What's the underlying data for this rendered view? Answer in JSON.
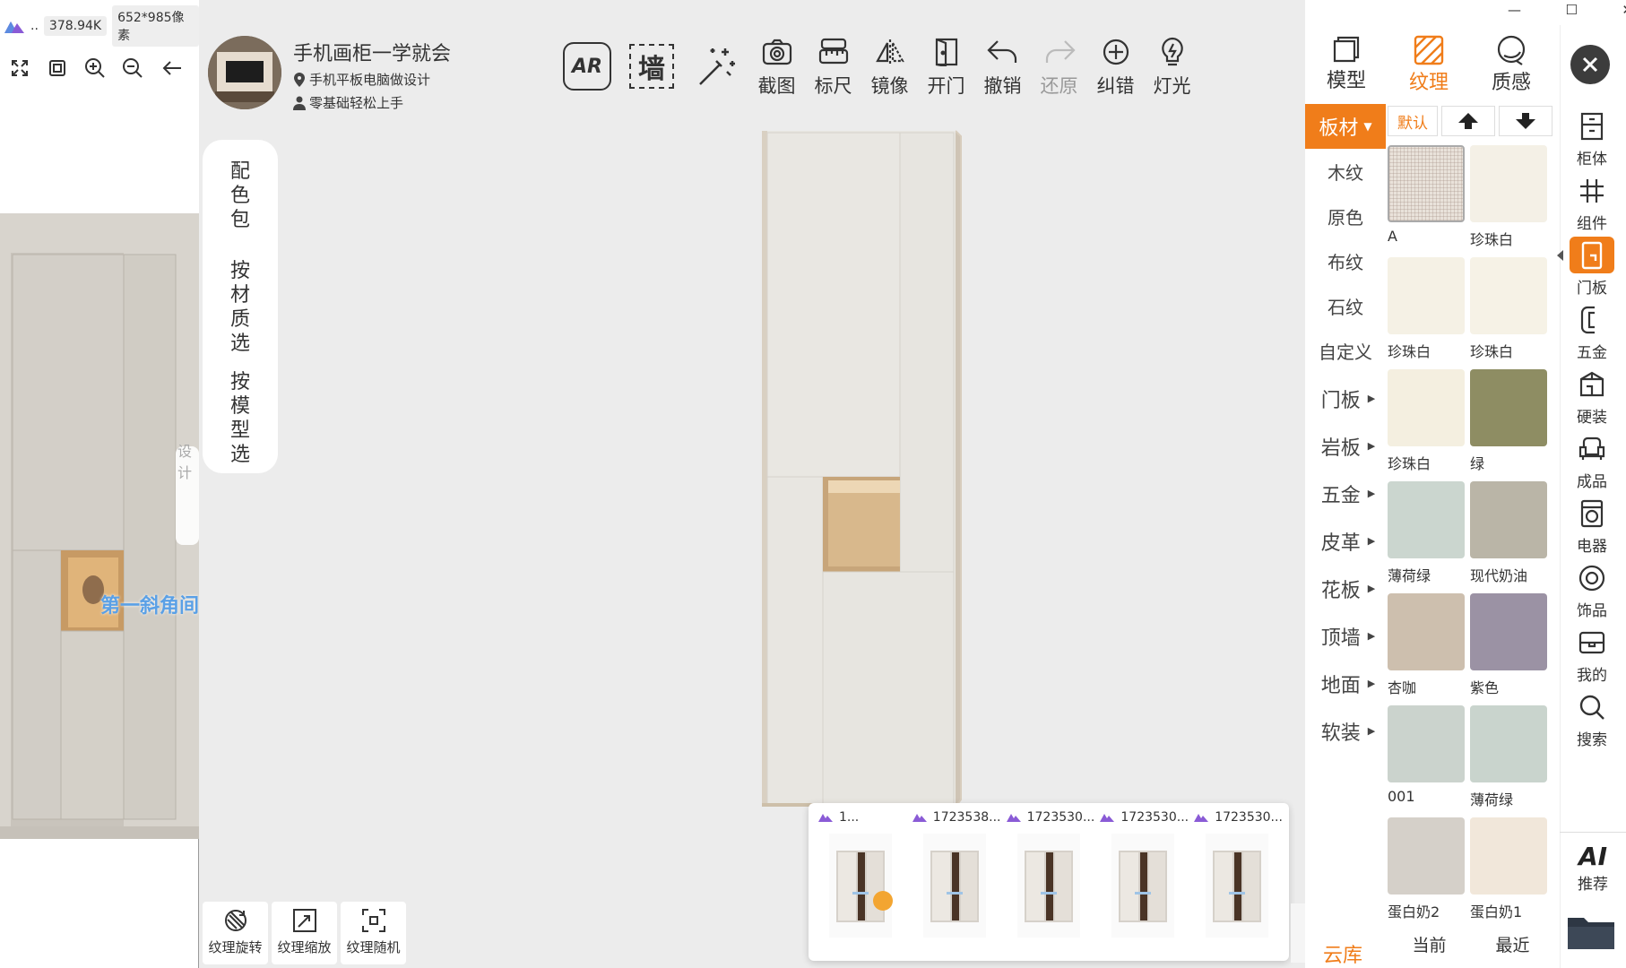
{
  "viewer": {
    "app_short": "..",
    "file_size": "378.94K",
    "dimensions": "652*985像素",
    "tools": [
      "expand-icon",
      "fit-icon",
      "zoom-in-icon",
      "zoom-out-icon",
      "back-arrow-icon"
    ],
    "caption": "第一斜角间",
    "watermark": "设计"
  },
  "window": {
    "minimize": "—",
    "maximize": "☐",
    "close": "✕"
  },
  "profile": {
    "title": "手机画柜一学就会",
    "line1": "手机平板电脑做设计",
    "line2": "零基础轻松上手"
  },
  "toolbar": {
    "ar_label": "AR",
    "wall_label": "墙",
    "items": [
      {
        "label": "截图",
        "icon": "camera-icon"
      },
      {
        "label": "标尺",
        "icon": "ruler-icon"
      },
      {
        "label": "镜像",
        "icon": "mirror-icon"
      },
      {
        "label": "开门",
        "icon": "door-open-icon"
      },
      {
        "label": "撤销",
        "icon": "undo-icon"
      },
      {
        "label": "还原",
        "icon": "redo-icon"
      },
      {
        "label": "纠错",
        "icon": "crosshair-icon"
      },
      {
        "label": "灯光",
        "icon": "bulb-icon"
      }
    ]
  },
  "side_pill": {
    "a": [
      "配",
      "色",
      "包"
    ],
    "b": [
      "按",
      "材",
      "质",
      "选"
    ],
    "c": [
      "按",
      "模",
      "型",
      "选"
    ]
  },
  "bottom_tools": [
    {
      "label": "纹理旋转",
      "icon": "texture-rotate-icon"
    },
    {
      "label": "纹理缩放",
      "icon": "texture-scale-icon"
    },
    {
      "label": "纹理随机",
      "icon": "texture-random-icon"
    }
  ],
  "thumbnails": [
    {
      "title": "1..."
    },
    {
      "title": "1723538..."
    },
    {
      "title": "1723530..."
    },
    {
      "title": "1723530..."
    },
    {
      "title": "1723530..."
    }
  ],
  "panel_tabs": [
    {
      "label": "模型",
      "active": false
    },
    {
      "label": "纹理",
      "active": true
    },
    {
      "label": "质感",
      "active": false
    }
  ],
  "categories": {
    "dropdown": "板材",
    "sub": [
      "木纹",
      "原色",
      "布纹",
      "石纹",
      "自定义"
    ],
    "groups": [
      "门板",
      "岩板",
      "五金",
      "皮革",
      "花板",
      "顶墙",
      "地面",
      "软装"
    ],
    "cloud": "云库"
  },
  "sort": {
    "default": "默认",
    "up": "up-arrow-icon",
    "down": "down-arrow-icon"
  },
  "swatches": [
    {
      "label": "A",
      "color": "#e9e2da",
      "selected": true
    },
    {
      "label": "珍珠白",
      "color": "#f4f0e6"
    },
    {
      "label": "珍珠白",
      "color": "#f5f1e5"
    },
    {
      "label": "珍珠白",
      "color": "#f6f2e6"
    },
    {
      "label": "珍珠白",
      "color": "#f4efe0"
    },
    {
      "label": "绿",
      "color": "#8e8d63"
    },
    {
      "label": "薄荷绿",
      "color": "#cbd6cf"
    },
    {
      "label": "现代奶油",
      "color": "#bab5a7"
    },
    {
      "label": "杏咖",
      "color": "#cdbfae"
    },
    {
      "label": "紫色",
      "color": "#9b92a4"
    },
    {
      "label": "001",
      "color": "#cbd3cd"
    },
    {
      "label": "薄荷绿",
      "color": "#c9d4cd"
    },
    {
      "label": "蛋白奶2",
      "color": "#d5d0c9"
    },
    {
      "label": "蛋白奶1",
      "color": "#f1e7da"
    }
  ],
  "bottom_tabs": [
    "当前",
    "最近"
  ],
  "right_tools": [
    {
      "label": "柜体",
      "icon": "cabinet-icon"
    },
    {
      "label": "组件",
      "icon": "grid-icon"
    },
    {
      "label": "门板",
      "icon": "door-panel-icon",
      "active": true
    },
    {
      "label": "五金",
      "icon": "hardware-icon"
    },
    {
      "label": "硬装",
      "icon": "hard-decor-icon"
    },
    {
      "label": "成品",
      "icon": "sofa-icon"
    },
    {
      "label": "电器",
      "icon": "washer-icon"
    },
    {
      "label": "饰品",
      "icon": "ornament-icon"
    },
    {
      "label": "我的",
      "icon": "my-box-icon"
    },
    {
      "label": "搜索",
      "icon": "search-icon"
    }
  ],
  "ai": {
    "title": "AI",
    "label": "推荐"
  },
  "colors": {
    "accent": "#f07d1a",
    "main_bg": "#ececec"
  }
}
